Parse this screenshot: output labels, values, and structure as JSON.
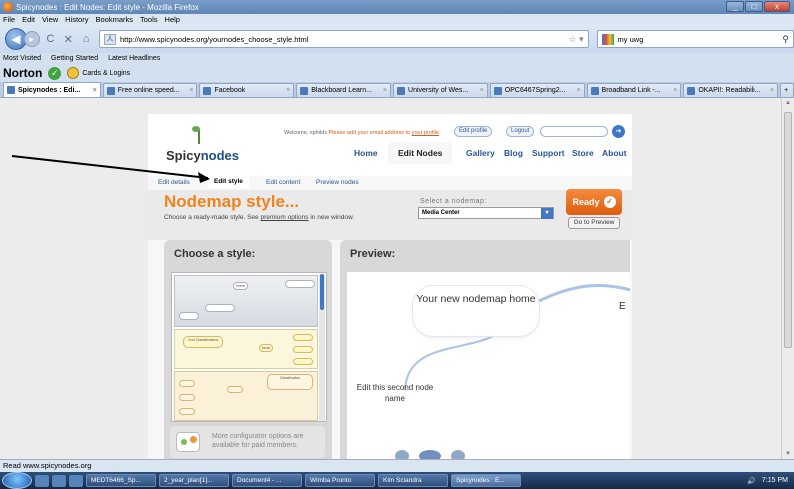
{
  "window": {
    "title": "Spicynodes : Edit Nodes: Edit style - Mozilla Firefox",
    "minimize": "_",
    "maximize": "□",
    "close": "x"
  },
  "menu": [
    "File",
    "Edit",
    "View",
    "History",
    "Bookmarks",
    "Tools",
    "Help"
  ],
  "nav": {
    "back_glyph": "◀",
    "forward_glyph": "▸",
    "reload_glyph": "C",
    "stop_glyph": "✕",
    "home_glyph": "⌂",
    "url": "http://www.spicynodes.org/yournodes_choose_style.html",
    "search_value": "my uwg"
  },
  "bookmarks": [
    "Most Visited",
    "Getting Started",
    "Latest Headlines"
  ],
  "norton": {
    "label": "Norton",
    "cards": "Cards & Logins"
  },
  "tabs": [
    {
      "label": "Spicynodes : Edi...",
      "active": true
    },
    {
      "label": "Free online speed..."
    },
    {
      "label": "Facebook"
    },
    {
      "label": "Blackboard Learn..."
    },
    {
      "label": "University of Wes..."
    },
    {
      "label": "OPC6467Spring2..."
    },
    {
      "label": "Broadband Link -..."
    },
    {
      "label": "OKAPI!: Readabili..."
    }
  ],
  "tabs_more": "+",
  "site": {
    "logo_a": "Spicy",
    "logo_b": "nodes",
    "welcome_a": "Welcome, sphilds",
    "welcome_b": "Please add your email address to",
    "welcome_link": "your profile",
    "edit_profile": "Edit profile",
    "logout": "Logout",
    "nav": [
      "Home",
      "Edit Nodes",
      "Gallery",
      "Blog",
      "Support",
      "Store",
      "About"
    ],
    "subnav": [
      "Edit details",
      "Edit style",
      "Edit content",
      "Preview nodes"
    ],
    "title": "Nodemap style...",
    "subtitle_a": "Choose a ready-made style. See",
    "subtitle_link": "premium options",
    "subtitle_b": "in new window.",
    "select_label": "Select a nodemap:",
    "select_value": "Media Center",
    "ready": "Ready",
    "goto_preview": "Go to Preview",
    "choose_style": "Choose a style:",
    "thumb_labels": [
      "Home",
      "Your Classifications",
      "Node",
      "Classification"
    ],
    "more_config": "More configurator options are available for paid members.",
    "preview": "Preview:",
    "home_node": "Your new nodemap home",
    "second_node": "Edit this second node name",
    "e_node": "E"
  },
  "status": "Read www.spicynodes.org",
  "taskbar": {
    "items": [
      "MEDT6466_Sp...",
      "2_year_plan[1]...",
      "Document4 - ...",
      "Wimba Pronto",
      "Kim Sciandra",
      "Spicynodes : E..."
    ],
    "clock": "7:15 PM"
  }
}
